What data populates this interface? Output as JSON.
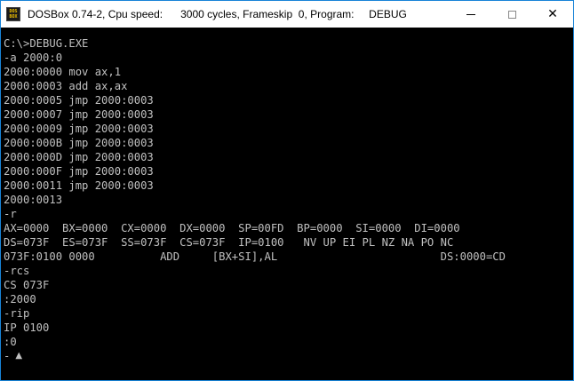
{
  "window": {
    "title": "DOSBox 0.74-2, Cpu speed:      3000 cycles, Frameskip  0, Program:     DEBUG",
    "icon_top": "DOS",
    "icon_bottom": "BOX",
    "min_icon": "minimize-icon",
    "max_icon": "maximize-icon",
    "close_icon": "close-icon",
    "close_glyph": "✕"
  },
  "console": {
    "lines": [
      "C:\\>DEBUG.EXE",
      "-a 2000:0",
      "2000:0000 mov ax,1",
      "2000:0003 add ax,ax",
      "2000:0005 jmp 2000:0003",
      "2000:0007 jmp 2000:0003",
      "2000:0009 jmp 2000:0003",
      "2000:000B jmp 2000:0003",
      "2000:000D jmp 2000:0003",
      "2000:000F jmp 2000:0003",
      "2000:0011 jmp 2000:0003",
      "2000:0013",
      "-r",
      "AX=0000  BX=0000  CX=0000  DX=0000  SP=00FD  BP=0000  SI=0000  DI=0000",
      "DS=073F  ES=073F  SS=073F  CS=073F  IP=0100   NV UP EI PL NZ NA PO NC",
      "073F:0100 0000          ADD     [BX+SI],AL                         DS:0000=CD",
      "-rcs",
      "CS 073F",
      ":2000",
      "-rip",
      "IP 0100",
      ":0"
    ],
    "prompt": "-",
    "cursor_glyph": "▲"
  },
  "colors": {
    "console_bg": "#000000",
    "console_text": "#c0c0c0",
    "window_border": "#1883d7"
  }
}
